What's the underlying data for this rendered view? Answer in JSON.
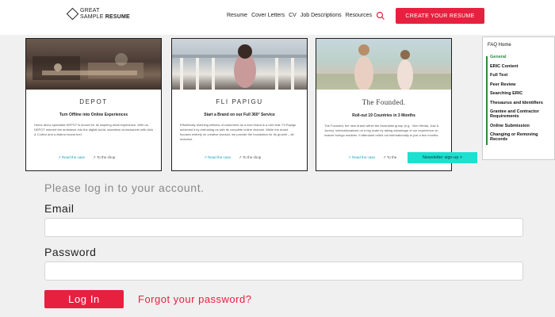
{
  "header": {
    "logo": {
      "line1": "GREAT",
      "line2": "SAMPLE",
      "line2b": "RESUME"
    },
    "nav": [
      "Resume",
      "Cover Letters",
      "CV",
      "Job Descriptions",
      "Resources"
    ],
    "cta_label": "CREATE YOUR RESUME",
    "accent_color": "#e8203f"
  },
  "cards": [
    {
      "brand": "DEPOT",
      "title": "Turn Offline into Online Experiences",
      "description": "Home decor specialist DEPOT is known for its inspiring retail experience. With us, DEPOT entered the ambiance into the digital world, seamless omnichannel with click & Collect and a distinct brand feel.",
      "read_label": "↗ Read the case",
      "shop_label": "↗ To the shop"
    },
    {
      "brand": "FLI PAPIGU",
      "title": "Start a Brand on our Full 360° Service",
      "description": "Effortlessly reaching millions of customers as a new brand is a rare feat. Fli Papigu achieved it by entrusting us with its complete online channel. While the brand focuses entirely on creative product, we provide the foundation for its growth – all included.",
      "read_label": "↗ Read the case",
      "shop_label": "↗ To the shop"
    },
    {
      "brand": "The Founded.",
      "title": "Roll-out 19 Countries in 3 Months",
      "description": "The Founded, the new brand within the Australian group (e.g., Veer Media, Just & Jones), internationalized on a big scale by taking advantage of our experience on mature foreign markets. It afterward rolled out internationally to just a few months.",
      "read_label": "↗ Read the case",
      "shop_label": "↗ To the"
    }
  ],
  "faq": {
    "title": "FAQ Home",
    "items": [
      "General",
      "ERIC Content",
      "Full Text",
      "Peer Review",
      "Searching ERIC",
      "Thesaurus and Identifiers",
      "Grantee and Contractor Requirements",
      "Online Submission",
      "Changing or Removing Records"
    ],
    "active_index": 0
  },
  "newsletter": {
    "label": "Newsletter sign-up >"
  },
  "login": {
    "prompt": "Please log in to your account.",
    "email_label": "Email",
    "email_value": "",
    "password_label": "Password",
    "password_value": "",
    "login_label": "Log In",
    "forgot_label": "Forgot your password?"
  }
}
